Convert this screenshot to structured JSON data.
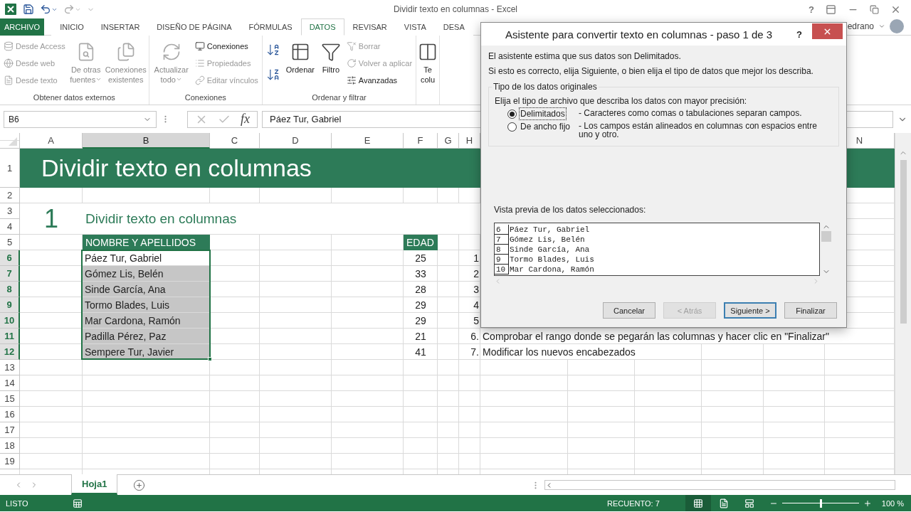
{
  "app": {
    "title": "Dividir texto en columnas - Excel",
    "help": "?",
    "user": "edrano"
  },
  "tabs": [
    {
      "label": "ARCHIVO",
      "kind": "file",
      "selected": false
    },
    {
      "label": "INICIO",
      "kind": "tab",
      "selected": false
    },
    {
      "label": "INSERTAR",
      "kind": "tab",
      "selected": false
    },
    {
      "label": "DISEÑO DE PÁGINA",
      "kind": "tab",
      "selected": false
    },
    {
      "label": "FÓRMULAS",
      "kind": "tab",
      "selected": false
    },
    {
      "label": "DATOS",
      "kind": "tab",
      "selected": true
    },
    {
      "label": "REVISAR",
      "kind": "tab",
      "selected": false
    },
    {
      "label": "VISTA",
      "kind": "tab",
      "selected": false
    },
    {
      "label": "DESA",
      "kind": "tab",
      "selected": false
    }
  ],
  "ribbon": {
    "groups": [
      {
        "label": "Obtener datos externos",
        "items": [
          {
            "kind": "stack",
            "items": [
              {
                "kind": "small",
                "label": "Desde Access",
                "disabled": true
              },
              {
                "kind": "small",
                "label": "Desde web",
                "disabled": true
              },
              {
                "kind": "small",
                "label": "Desde texto",
                "disabled": true
              }
            ]
          },
          {
            "kind": "large",
            "label": "De otras fuentes",
            "disabled": true,
            "dropdown": true
          },
          {
            "kind": "large",
            "label": "Conexiones existentes",
            "disabled": true,
            "dropdown": false
          }
        ]
      },
      {
        "label": "Conexiones",
        "items": [
          {
            "kind": "large",
            "label": "Actualizar todo",
            "disabled": true,
            "dropdown": true
          },
          {
            "kind": "stack",
            "items": [
              {
                "kind": "small",
                "label": "Conexiones",
                "disabled": false
              },
              {
                "kind": "small",
                "label": "Propiedades",
                "disabled": true
              },
              {
                "kind": "small",
                "label": "Editar vínculos",
                "disabled": true
              }
            ]
          }
        ]
      },
      {
        "label": "Ordenar y filtrar",
        "items": [
          {
            "kind": "stack",
            "items": [
              {
                "kind": "icon",
                "disabled": false
              },
              {
                "kind": "icon",
                "disabled": false
              }
            ]
          },
          {
            "kind": "large",
            "label": "Ordenar",
            "disabled": false,
            "dropdown": false
          },
          {
            "kind": "large",
            "label": "Filtro",
            "disabled": false,
            "dropdown": false
          },
          {
            "kind": "stack",
            "items": [
              {
                "kind": "small",
                "label": "Borrar",
                "disabled": true
              },
              {
                "kind": "small",
                "label": "Volver a aplicar",
                "disabled": true
              },
              {
                "kind": "small",
                "label": "Avanzadas",
                "disabled": false
              }
            ]
          }
        ]
      },
      {
        "items": [
          {
            "kind": "large",
            "label": "Te colu",
            "disabled": false,
            "dropdown": false
          }
        ]
      }
    ]
  },
  "formula_bar": {
    "name_box": "B6",
    "function_label": "fx",
    "formula": "Páez Tur, Gabriel"
  },
  "sheet": {
    "columns": [
      {
        "label": "A",
        "selected": false
      },
      {
        "label": "B",
        "selected": true
      },
      {
        "label": "C",
        "selected": false
      },
      {
        "label": "D",
        "selected": false
      },
      {
        "label": "E",
        "selected": false
      },
      {
        "label": "F",
        "selected": false
      },
      {
        "label": "G",
        "selected": false
      },
      {
        "label": "H",
        "selected": false
      },
      {
        "label": "N",
        "selected": false
      }
    ],
    "rows": [
      {
        "label": "1",
        "selected": false
      },
      {
        "label": "2",
        "selected": false
      },
      {
        "label": "3",
        "selected": false
      },
      {
        "label": "4",
        "selected": false
      },
      {
        "label": "5",
        "selected": false
      },
      {
        "label": "6",
        "selected": true
      },
      {
        "label": "7",
        "selected": true
      },
      {
        "label": "8",
        "selected": true
      },
      {
        "label": "9",
        "selected": true
      },
      {
        "label": "10",
        "selected": true
      },
      {
        "label": "11",
        "selected": true
      },
      {
        "label": "12",
        "selected": true
      },
      {
        "label": "13",
        "selected": false
      },
      {
        "label": "14",
        "selected": false
      },
      {
        "label": "15",
        "selected": false
      },
      {
        "label": "16",
        "selected": false
      },
      {
        "label": "17",
        "selected": false
      },
      {
        "label": "18",
        "selected": false
      },
      {
        "label": "19",
        "selected": false
      }
    ],
    "title": "Dividir texto en columnas",
    "section": {
      "number": "1",
      "title": "Dividir texto en columnas"
    },
    "headers": [
      "NOMBRE Y APELLIDOS",
      "EDAD"
    ],
    "records": [
      {
        "name": "Páez Tur, Gabriel",
        "age": "25",
        "step": "1",
        "selected": true,
        "active": true
      },
      {
        "name": "Gómez Lis, Belén",
        "age": "33",
        "step": "2",
        "selected": true,
        "active": false
      },
      {
        "name": "Sinde García, Ana",
        "age": "28",
        "step": "3",
        "selected": true,
        "active": false
      },
      {
        "name": "Tormo Blades, Luis",
        "age": "29",
        "step": "4",
        "selected": true,
        "active": false
      },
      {
        "name": "Mar Cardona, Ramón",
        "age": "29",
        "step": "5",
        "selected": true,
        "active": false
      },
      {
        "name": "Padilla Pérez, Paz",
        "age": "21",
        "step": "6.",
        "note": "Comprobar el rango donde se pegarán las columnas y hacer clic en \"Finalizar\"",
        "selected": true,
        "active": false
      },
      {
        "name": "Sempere Tur, Javier",
        "age": "41",
        "step": "7.",
        "note": "Modificar los nuevos encabezados",
        "selected": true,
        "active": false
      }
    ]
  },
  "sheet_tabs": [
    {
      "label": "Hoja1",
      "selected": true
    }
  ],
  "status_bar": {
    "mode": "LISTO",
    "count": "RECUENTO: 7",
    "views": [
      {
        "selected": true
      },
      {
        "selected": false
      },
      {
        "selected": false
      }
    ],
    "zoom": {
      "level": 0.5,
      "reading": "100 %"
    }
  },
  "dialog": {
    "title": "Asistente para convertir texto en columnas - paso 1 de 3",
    "help": "?",
    "lines": [
      "El asistente estima que sus datos son Delimitados.",
      "Si esto es correcto, elija Siguiente, o bien elija el tipo de datos que mejor los describa."
    ],
    "group": {
      "legend": "Tipo de los datos originales",
      "prompt": "Elija el tipo de archivo que describa los datos con mayor precisión:",
      "options": [
        {
          "label": "Delimitados",
          "description": "- Caracteres como comas o tabulaciones separan campos.",
          "selected": true,
          "focused": true
        },
        {
          "label": "De ancho fijo",
          "description": "- Los campos están alineados en columnas con espacios entre uno y otro.",
          "selected": false,
          "focused": false
        }
      ]
    },
    "preview": {
      "label": "Vista previa de los datos seleccionados:",
      "rows": [
        {
          "number": "6",
          "text": "Páez Tur, Gabriel"
        },
        {
          "number": "7",
          "text": "Gómez Lis, Belén"
        },
        {
          "number": "8",
          "text": "Sinde García, Ana"
        },
        {
          "number": "9",
          "text": "Tormo Blades, Luis"
        },
        {
          "number": "10",
          "text": "Mar Cardona, Ramón"
        }
      ]
    },
    "buttons": [
      {
        "label": "Cancelar",
        "disabled": false,
        "default": false
      },
      {
        "label": "< Atrás",
        "disabled": true,
        "default": false
      },
      {
        "label": "Siguiente >",
        "disabled": false,
        "default": true
      },
      {
        "label": "Finalizar",
        "disabled": false,
        "default": false
      }
    ]
  }
}
